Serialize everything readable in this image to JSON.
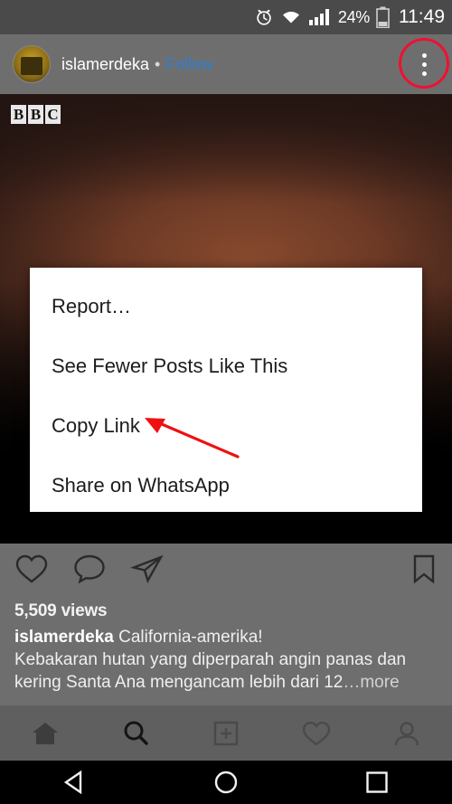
{
  "statusbar": {
    "alarm_icon": "alarm-clock-icon",
    "wifi_icon": "wifi-icon",
    "signal_icon": "cellular-signal-icon",
    "battery_percent": "24%",
    "battery_icon": "battery-icon",
    "clock": "11:49"
  },
  "post_header": {
    "avatar": "user-avatar",
    "username": "islamerdeka",
    "separator": "•",
    "follow_label": "Follow",
    "more_icon": "overflow-menu-icon",
    "highlight_color": "#ee1133"
  },
  "photo": {
    "watermark": [
      "B",
      "B",
      "C"
    ]
  },
  "actions": {
    "like_icon": "heart-icon",
    "comment_icon": "comment-bubble-icon",
    "share_icon": "direct-share-icon",
    "save_icon": "bookmark-icon"
  },
  "caption": {
    "views": "5,509 views",
    "username": "islamerdeka",
    "text_line1": "California-amerika!",
    "text_line2": "Kebakaran hutan yang diperparah angin panas dan",
    "text_line3": "kering Santa Ana mengancam lebih dari 12",
    "ellipsis": "…",
    "more_label": "more"
  },
  "dialog": {
    "options": [
      {
        "label": "Report…"
      },
      {
        "label": "See Fewer Posts Like This"
      },
      {
        "label": "Copy Link"
      },
      {
        "label": "Share on WhatsApp"
      }
    ]
  },
  "bottom_nav": {
    "items": [
      {
        "icon": "home-icon",
        "label": "Home"
      },
      {
        "icon": "search-icon",
        "label": "Search"
      },
      {
        "icon": "add-post-icon",
        "label": "Add"
      },
      {
        "icon": "activity-heart-icon",
        "label": "Activity"
      },
      {
        "icon": "profile-person-icon",
        "label": "Profile"
      }
    ]
  },
  "system_nav": {
    "back_icon": "back-triangle-icon",
    "home_icon": "home-circle-icon",
    "recents_icon": "recents-square-icon"
  },
  "annotation": {
    "arrow_icon": "red-pointer-arrow",
    "arrow_color": "#ee1111"
  }
}
